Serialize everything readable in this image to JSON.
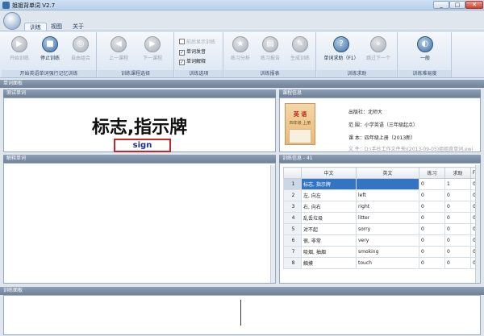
{
  "window": {
    "title": "姐姐背单词 V2.7",
    "minimize": "_",
    "maximize": "□",
    "close": "✕"
  },
  "tabs": [
    {
      "label": "训练"
    },
    {
      "label": "视图"
    },
    {
      "label": "关于"
    }
  ],
  "ribbon": {
    "groups": [
      {
        "label": "开始英语单词强行记忆训练"
      },
      {
        "label": "训练课程选择"
      },
      {
        "label": "训练选项"
      },
      {
        "label": "训练报表"
      },
      {
        "label": "训练求助"
      },
      {
        "label": "训练难易度"
      }
    ],
    "buttons": {
      "start": "开始训练",
      "stop": "停止训练",
      "free_combo": "自由组合",
      "prev": "上一课程",
      "next": "下一课程",
      "stats": "练习分析",
      "report": "练习报告",
      "generate": "生成训练",
      "help": "单词求助（F1）",
      "skip": "跳过下一个",
      "difficulty": "一般"
    },
    "options": [
      {
        "label": "前后显示训练",
        "checked": false,
        "enabled": false
      },
      {
        "label": "单词发音",
        "checked": true,
        "enabled": true
      },
      {
        "label": "单词解释",
        "checked": true,
        "enabled": true
      }
    ]
  },
  "panels": {
    "word_panel": "单词面板",
    "test_word": "测试单词",
    "explain": "解释单词",
    "course_info": "课程信息",
    "train_info": "训练信息 - 41",
    "train_panel": "训练面板"
  },
  "test": {
    "chinese": "标志,指示牌",
    "answer": "sign"
  },
  "course": {
    "publisher": "出版社：北师大",
    "range": "范  围：小学英语（三年级起点）",
    "volume": "课  本：四年级上册（2013新）",
    "file": "文  件：D:\\手抄工作文件夹\\(2013-09-05)姐姐背单词.ewi",
    "book_title": "英 语",
    "book_subtitle": "四年级 上册"
  },
  "table": {
    "columns": [
      "",
      "中文",
      "英文",
      "练习",
      "求助",
      "F"
    ],
    "rows": [
      {
        "n": "1",
        "cn": "标志, 指示牌",
        "en": "",
        "p": "0",
        "h": "1",
        "f": "0"
      },
      {
        "n": "2",
        "cn": "左, 向左",
        "en": "left",
        "p": "0",
        "h": "0",
        "f": "0"
      },
      {
        "n": "3",
        "cn": "右, 向右",
        "en": "right",
        "p": "0",
        "h": "0",
        "f": "0"
      },
      {
        "n": "4",
        "cn": "乱丢垃圾",
        "en": "litter",
        "p": "0",
        "h": "0",
        "f": "0"
      },
      {
        "n": "5",
        "cn": "对不起",
        "en": "sorry",
        "p": "0",
        "h": "0",
        "f": "0"
      },
      {
        "n": "6",
        "cn": "很, 非常",
        "en": "very",
        "p": "0",
        "h": "0",
        "f": "0"
      },
      {
        "n": "7",
        "cn": "吸烟, 抽烟",
        "en": "smoking",
        "p": "0",
        "h": "0",
        "f": "0"
      },
      {
        "n": "8",
        "cn": "触摸",
        "en": "touch",
        "p": "0",
        "h": "0",
        "f": "0"
      }
    ]
  },
  "colors": {
    "accent": "#3375c2",
    "answer_border": "#c1272d",
    "panel_header": "#7a8ca3"
  }
}
